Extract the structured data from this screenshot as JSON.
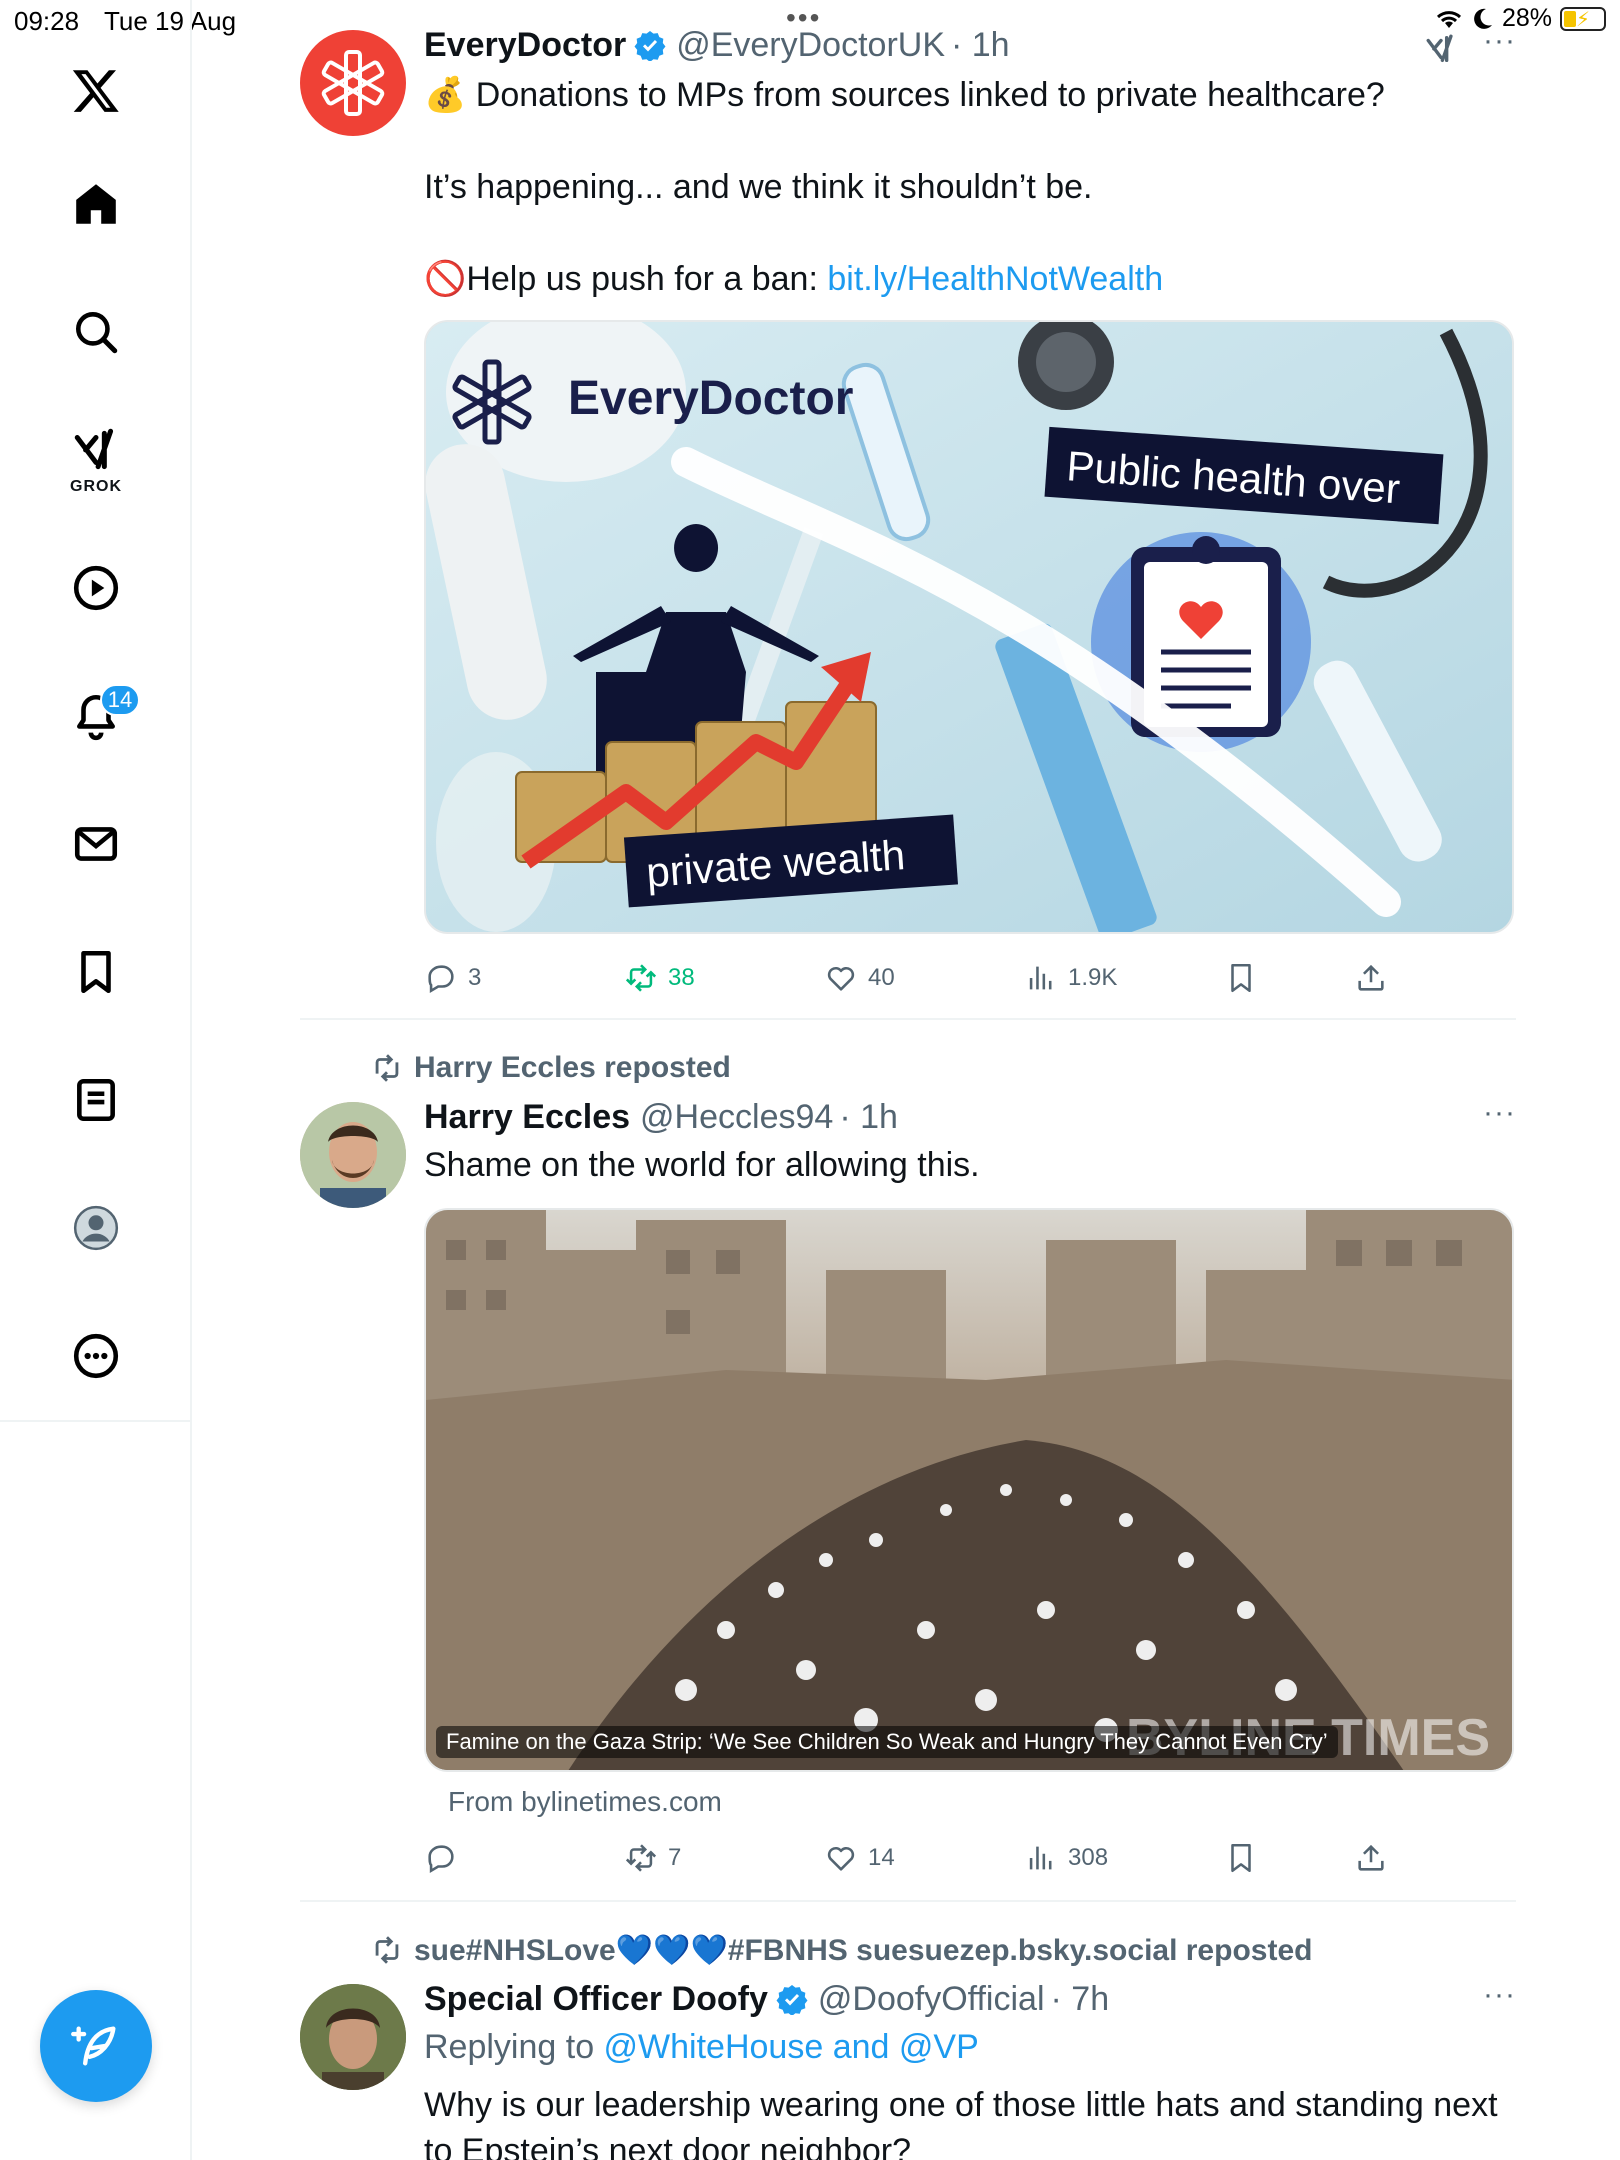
{
  "status_bar": {
    "time": "09:28",
    "date": "Tue 19 Aug",
    "battery": "28%"
  },
  "sidebar": {
    "grok_label": "GROK",
    "notifications_count": "14"
  },
  "colors": {
    "accent": "#1d9bf0",
    "repost_green": "#00ba7c",
    "muted": "#536471",
    "everydoctor_red": "#ef4136"
  },
  "tweets": [
    {
      "name": "EveryDoctor",
      "handle": "@EveryDoctorUK",
      "time": "· 1h",
      "line1_emoji": "💰",
      "line1": "Donations to MPs from sources linked to private healthcare?",
      "line2": "It’s happening... and we think it shouldn’t be.",
      "line3_emoji": "🚫",
      "line3": "Help us push for a ban: ",
      "link": "bit.ly/HealthNotWealth",
      "image": {
        "brand": "EveryDoctor",
        "banner_top": "Public health over",
        "banner_bottom": "private wealth"
      },
      "stats": {
        "replies": "3",
        "reposts": "38",
        "likes": "40",
        "views": "1.9K"
      }
    },
    {
      "repost_by": "Harry Eccles reposted",
      "name": "Harry Eccles",
      "handle": "@Heccles94",
      "time": "· 1h",
      "text": "Shame on the world for allowing this.",
      "card_caption": "Famine on the Gaza Strip: ‘We See Children So Weak and Hungry They Cannot Even Cry’",
      "card_watermark": "BYLINE TIMES",
      "card_from": "From bylinetimes.com",
      "stats": {
        "replies": "",
        "reposts": "7",
        "likes": "14",
        "views": "308"
      }
    },
    {
      "repost_by": "sue#NHSLove💙💙💙#FBNHS suesuezep.bsky.social reposted",
      "name": "Special Officer Doofy",
      "handle": "@DoofyOfficial",
      "time": "· 7h",
      "replying_prefix": "Replying to ",
      "replying_to": "@WhiteHouse and @VP",
      "text": "Why is our leadership wearing one of those little hats and standing next to Epstein’s next door neighbor?"
    }
  ]
}
